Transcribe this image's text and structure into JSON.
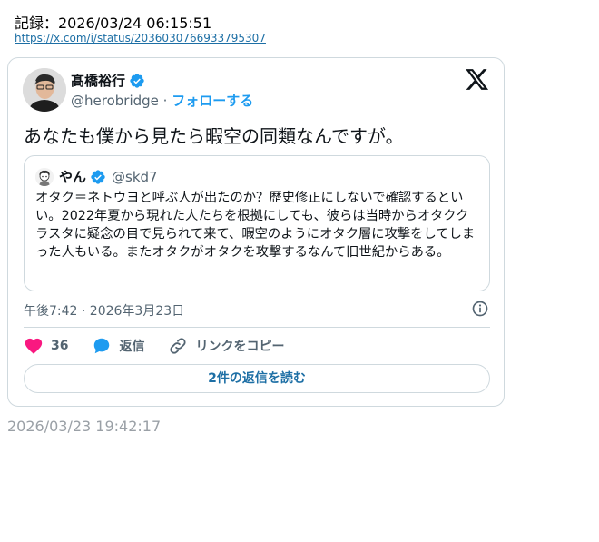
{
  "header": {
    "record_text": "記録：2026/03/24 06:15:51",
    "source_url": "https://x.com/i/status/2036030766933795307"
  },
  "tweet": {
    "author_name": "髙橋裕行",
    "author_handle": "@herobridge",
    "separator": "·",
    "follow_label": "フォローする",
    "text": "あなたも僕から見たら暇空の同類なんですが。",
    "timestamp": "午後7:42 · 2026年3月23日",
    "likes": "36",
    "reply_label": "返信",
    "copy_link_label": "リンクをコピー",
    "read_replies_label": "2件の返信を読む"
  },
  "quote": {
    "author_name": "やん",
    "author_handle": "@skd7",
    "text": "オタク＝ネトウヨと呼ぶ人が出たのか？歴史修正にしないで確認するといい。2022年夏から現れた人たちを根拠にしても、彼らは当時からオタククラスタに疑念の目で見られて来て、暇空のようにオタク層に攻撃をしてしまった人もいる。またオタクがオタクを攻撃するなんて旧世紀からある。"
  },
  "footer": {
    "captured_time": "2026/03/23 19:42:17"
  },
  "icons": {
    "verified": "verified-badge-icon",
    "x_logo": "x-logo-icon",
    "info": "info-icon",
    "heart": "heart-icon",
    "reply": "speech-bubble-icon",
    "link": "link-icon"
  },
  "colors": {
    "accent": "#1d9bf0",
    "heart": "#f91880",
    "muted": "#536471",
    "border": "#cfd9de"
  }
}
